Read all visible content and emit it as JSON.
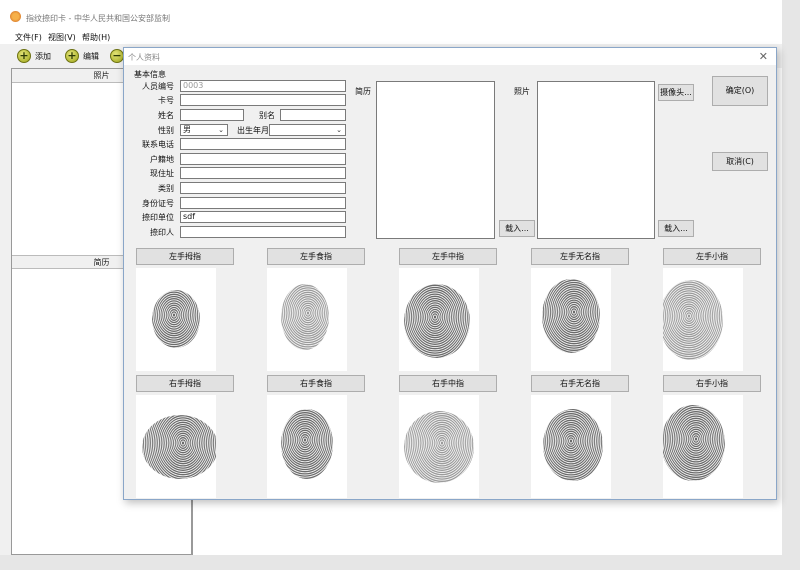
{
  "window": {
    "title": "指纹捺印卡 - 中华人民共和国公安部监制"
  },
  "menu": [
    {
      "label": "文件(F)"
    },
    {
      "label": "视图(V)"
    },
    {
      "label": "帮助(H)"
    }
  ],
  "toolbar": {
    "add_label": "添加",
    "edit_label": "编辑"
  },
  "left_panel": {
    "photo_header": "照片",
    "resume_header": "简历"
  },
  "dialog": {
    "title": "个人资料",
    "section_label": "基本信息",
    "fields": {
      "person_id": {
        "label": "人员编号",
        "value": "0003"
      },
      "card_no": {
        "label": "卡号",
        "value": ""
      },
      "name": {
        "label": "姓名",
        "value": ""
      },
      "alias": {
        "label": "别名",
        "value": ""
      },
      "gender": {
        "label": "性别",
        "value": "男"
      },
      "birth": {
        "label": "出生年月",
        "value": ""
      },
      "phone": {
        "label": "联系电话",
        "value": ""
      },
      "domicile": {
        "label": "户籍地",
        "value": ""
      },
      "address": {
        "label": "现住址",
        "value": ""
      },
      "category": {
        "label": "类别",
        "value": ""
      },
      "id_number": {
        "label": "身份证号",
        "value": ""
      },
      "unit": {
        "label": "捺印单位",
        "value": "sdf"
      },
      "printer": {
        "label": "捺印人",
        "value": ""
      }
    },
    "resume_label": "简历",
    "photo_label": "照片",
    "load_resume_button": "载入...",
    "camera_button": "摄像头...",
    "load_photo_button": "载入...",
    "ok_button": "确定(O)",
    "cancel_button": "取消(C)",
    "left_fingers": [
      "左手拇指",
      "左手食指",
      "左手中指",
      "左手无名指",
      "左手小指"
    ],
    "right_fingers": [
      "右手拇指",
      "右手食指",
      "右手中指",
      "右手无名指",
      "右手小指"
    ]
  }
}
